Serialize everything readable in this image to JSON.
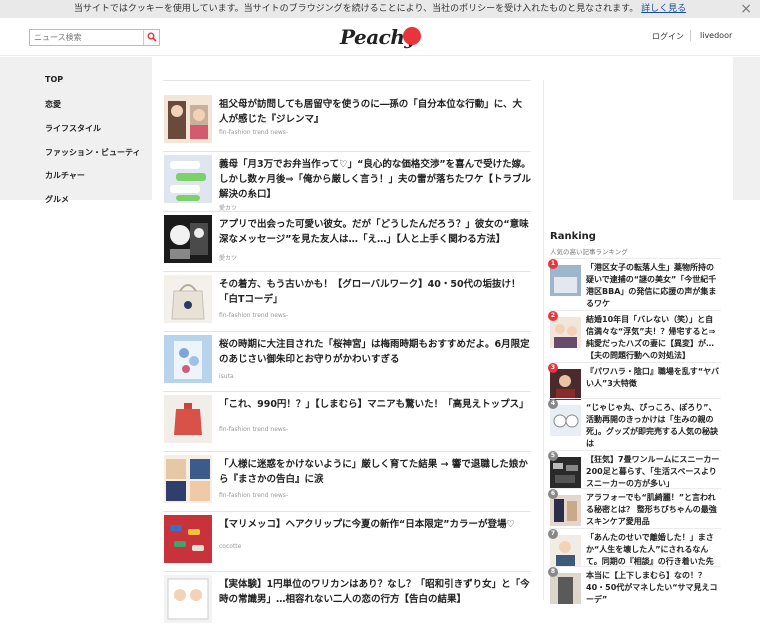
{
  "cookie": {
    "text": "当サイトではクッキーを使用しています。当サイトのブラウジングを続けることにより、当社のポリシーを受け入れたものと見なされます。",
    "link": "詳しく見る",
    "close": "×"
  },
  "header": {
    "search_placeholder": "ニュース検索",
    "logo": "Peachy",
    "login": "ログイン",
    "livedoor": "livedoor"
  },
  "sidebar": {
    "items": [
      "TOP",
      "恋愛",
      "ライフスタイル",
      "ファッション・ビューティ",
      "カルチャー",
      "グルメ"
    ]
  },
  "articles": [
    {
      "title": "祖父母が訪問しても居留守を使うのに―孫の「自分本位な行動」に、大人が感じた『ジレンマ』",
      "source": "fin-fashion trend news-"
    },
    {
      "title": "義母「月3万でお弁当作って♡」“良心的な価格交渉”を喜んで受けた嫁。しかし数ヶ月後⇒「俺から厳しく言う！」夫の雷が落ちたワケ【トラブル解決の糸口】",
      "source": "愛カツ"
    },
    {
      "title": "アプリで出会った可愛い彼女。だが「どうしたんだろう？」彼女の“意味深なメッセージ”を見た友人は…「え…」【人と上手く関わる方法】",
      "source": "愛カツ"
    },
    {
      "title": "その着方、もう古いかも！【グローバルワーク】40・50代の垢抜け！「白Tコーデ」",
      "source": "fin-fashion trend news-"
    },
    {
      "title": "桜の時期に大注目された「桜神宮」は梅雨時期もおすすめだよ。6月限定のあじさい御朱印とお守りがかわいすぎる",
      "source": "isuta"
    },
    {
      "title": "「これ、990円！？」【しまむら】マニアも驚いた！「高見えトップス」",
      "source": "fin-fashion trend news-"
    },
    {
      "title": "「人様に迷惑をかけないように」厳しく育てた結果 → 響で退職した娘から『まさかの告白』に涙",
      "source": "fin-fashion trend news-"
    },
    {
      "title": "【マリメッコ】ヘアクリップに今夏の新作“日本限定”カラーが登場♡",
      "source": "cocotte"
    },
    {
      "title": "【実体験】1円単位のワリカンはあり？なし？「昭和引きずり女」と「今時の常識男」…相容れない二人の恋の行方【告白の結果】",
      "source": ""
    }
  ],
  "ranking": {
    "title": "Ranking",
    "subtitle": "人気の高い記事ランキング",
    "items": [
      {
        "rank": "1",
        "text": "「港区女子の転落人生」薬物所持の疑いで逮捕の“謎の美女”「今世紀千港区BBA」の発信に応援の声が集まるワケ"
      },
      {
        "rank": "2",
        "text": "結婚10年目「バレない（笑）」と自信満々な“浮気”夫！？帰宅すると⇒純愛だったハズの妻に【異変】が…【夫の問題行動への対処法】"
      },
      {
        "rank": "3",
        "text": "『パワハラ・陰口』職場を乱す“ヤバい人”3大特徴"
      },
      {
        "rank": "4",
        "text": "“じゃじゃ丸、ぴっころ、ぽろり”、活動再開のきっかけは「生みの親の死」。グッズが即完売する人気の秘訣は"
      },
      {
        "rank": "5",
        "text": "【狂気】7畳ワンルームにスニーカー200足と暮らす、「生活スペースよりスニーカーの方が多い」"
      },
      {
        "rank": "6",
        "text": "アラフォーでも“肌綺麗！”と言われる秘密とは？ 整形ちびちゃんの最強スキンケア愛用品"
      },
      {
        "rank": "7",
        "text": "「あんたのせいで離婚した！」まさか“人生を壊した人”にされるなんて。同期の『相談』の行き着いた先"
      },
      {
        "rank": "8",
        "text": "本当に【上下しまむら】なの！？40・50代がマネしたい“サマ見えコーデ”"
      }
    ]
  },
  "colors": {
    "accent": "#e8343c",
    "link": "#1a4fa0",
    "rank_top": "#e8343c",
    "rank_other": "#888888"
  }
}
